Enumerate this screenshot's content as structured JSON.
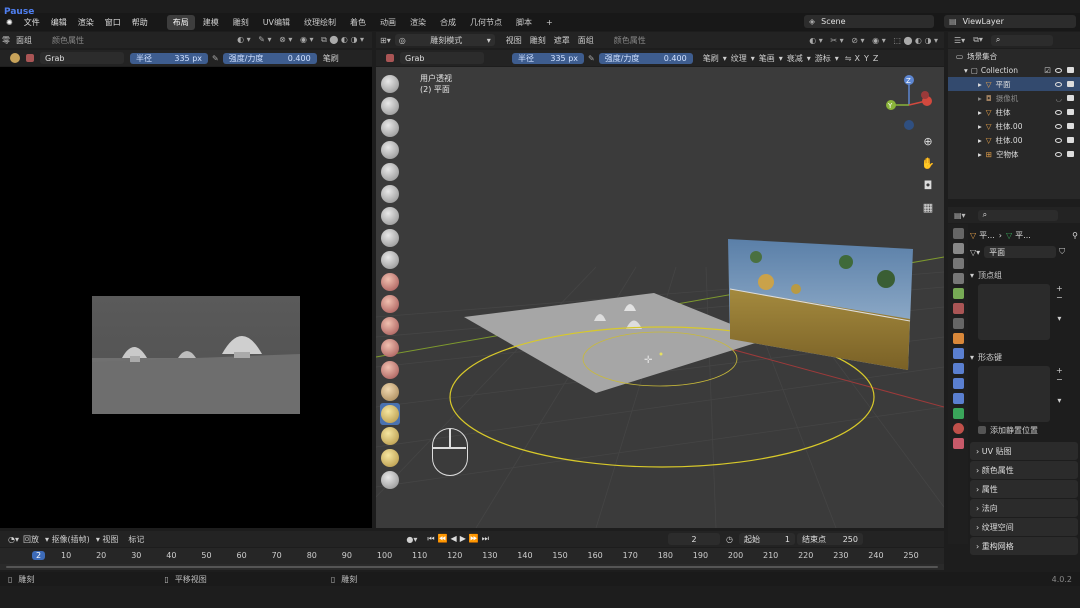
{
  "pause": "Pause",
  "menu": [
    "文件",
    "编辑",
    "渲染",
    "窗口",
    "帮助"
  ],
  "workspaces": [
    "布局",
    "建模",
    "雕刻",
    "UV编辑",
    "纹理绘制",
    "着色",
    "动画",
    "渲染",
    "合成",
    "几何节点",
    "脚本"
  ],
  "scene": {
    "label": "Scene",
    "viewlayer": "ViewLayer"
  },
  "left_header": {
    "items": [
      "零",
      "面组",
      "颜色属性"
    ]
  },
  "left_brush": {
    "name": "Grab",
    "radius_label": "半径",
    "radius_val": "335 px",
    "strength_label": "强度/力度",
    "strength_val": "0.400",
    "brush": "笔刷"
  },
  "vp_header": {
    "mode": "雕刻模式",
    "items": [
      "视图",
      "雕刻",
      "遮罩",
      "面组",
      "颜色属性"
    ]
  },
  "vp_brush": {
    "name": "Grab",
    "radius_label": "半径",
    "radius_val": "335 px",
    "strength_label": "强度/力度",
    "strength_val": "0.400",
    "items": [
      "笔刷",
      "纹理",
      "笔画",
      "衰减",
      "游标"
    ]
  },
  "xyz": [
    "X",
    "Y",
    "Z"
  ],
  "viewport": {
    "title": "用户透视",
    "subtitle": "(2) 平面"
  },
  "outliner": {
    "root": "场景集合",
    "collection": "Collection",
    "items": [
      "平面",
      "摄像机",
      "柱体",
      "柱体.00",
      "柱体.00",
      "空物体"
    ]
  },
  "props": {
    "crumb1": "平...",
    "crumb2": "平...",
    "mesh": "平面",
    "vg": "顶点组",
    "sk": "形态键",
    "rest": "添加静置位置",
    "panels": [
      "UV 贴图",
      "颜色属性",
      "属性",
      "法向",
      "纹理空间",
      "重构网格"
    ]
  },
  "timeline": {
    "items": [
      "回放",
      "抠像(插帧)",
      "视图",
      "标记"
    ],
    "frame": "2",
    "start_label": "起始",
    "start": "1",
    "end_label": "结束点",
    "end": "250",
    "ruler": [
      "2",
      "10",
      "20",
      "30",
      "40",
      "50",
      "60",
      "70",
      "80",
      "90",
      "100",
      "110",
      "120",
      "130",
      "140",
      "150",
      "160",
      "170",
      "180",
      "190",
      "200",
      "210",
      "220",
      "230",
      "240",
      "250"
    ]
  },
  "status": {
    "a": "雕刻",
    "b": "平移视图",
    "c": "雕刻",
    "version": "4.0.2"
  }
}
